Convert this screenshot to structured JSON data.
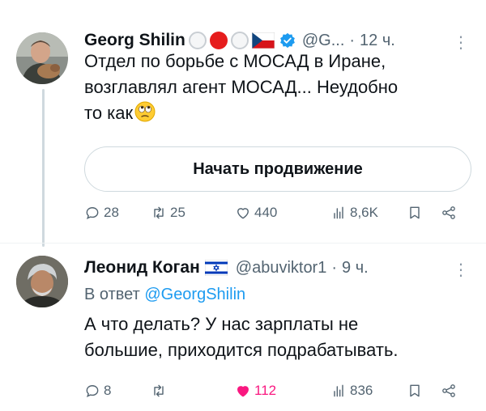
{
  "tweets": [
    {
      "author": {
        "name": "Georg Shilin",
        "handle": "@G...",
        "time": "12 ч.",
        "name_decorations": [
          "white-circle-emoji",
          "red-circle-emoji",
          "white-circle-emoji",
          "czech-flag-emoji",
          "verified-badge-icon"
        ]
      },
      "text_line_1": "Отдел по борьбе с МОСАД в Иране,",
      "text_line_2": "возглавлял агент МОСАД...  Неудобно",
      "text_line_3": "то как",
      "text_emoji": "face-with-rolling-eyes-emoji",
      "promote_button_label": "Начать продвижение",
      "stats": {
        "replies": "28",
        "retweets": "25",
        "likes": "440",
        "views": "8,6K"
      }
    },
    {
      "author": {
        "name": "Леонид Коган",
        "handle": "@abuviktor1",
        "time": "9 ч.",
        "name_decorations": [
          "israel-flag-emoji"
        ]
      },
      "reply_prefix": "В ответ",
      "reply_mention": "@GeorgShilin",
      "text_line_1": "А что делать? У нас зарплаты не",
      "text_line_2": "большие, приходится подрабатывать.",
      "stats": {
        "replies": "8",
        "retweets": "",
        "likes": "112",
        "views": "836"
      },
      "liked": true
    }
  ],
  "colors": {
    "text_primary": "#0f1419",
    "text_secondary": "#536471",
    "accent_blue": "#1d9bf0",
    "like_pink": "#f91880",
    "border": "#cfd9de"
  },
  "icons": {
    "more": "more-dots-icon",
    "reply": "reply-bubble-icon",
    "retweet": "retweet-icon",
    "like": "heart-icon",
    "views": "views-bar-chart-icon",
    "bookmark": "bookmark-icon",
    "share": "share-icon"
  }
}
